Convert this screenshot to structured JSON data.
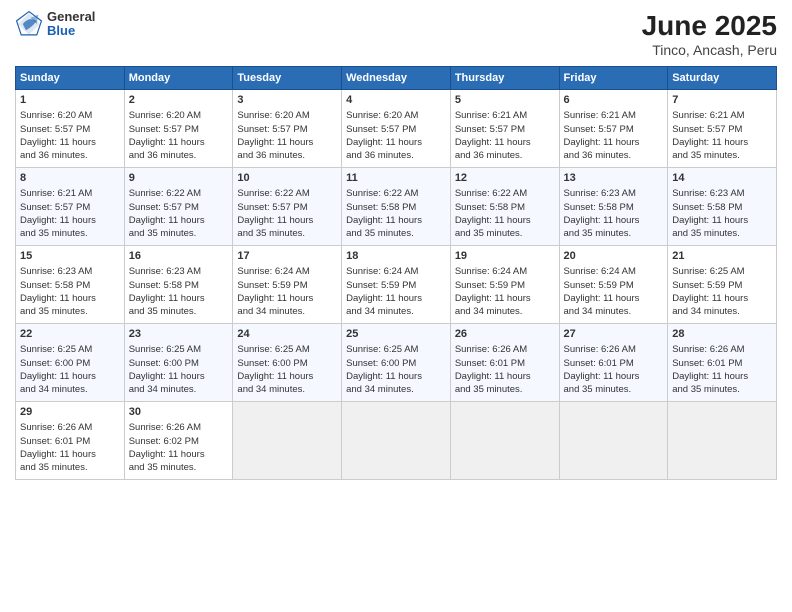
{
  "header": {
    "logo_general": "General",
    "logo_blue": "Blue",
    "main_title": "June 2025",
    "subtitle": "Tinco, Ancash, Peru"
  },
  "calendar": {
    "days_header": [
      "Sunday",
      "Monday",
      "Tuesday",
      "Wednesday",
      "Thursday",
      "Friday",
      "Saturday"
    ],
    "rows": [
      [
        {
          "day": "1",
          "lines": [
            "Sunrise: 6:20 AM",
            "Sunset: 5:57 PM",
            "Daylight: 11 hours",
            "and 36 minutes."
          ]
        },
        {
          "day": "2",
          "lines": [
            "Sunrise: 6:20 AM",
            "Sunset: 5:57 PM",
            "Daylight: 11 hours",
            "and 36 minutes."
          ]
        },
        {
          "day": "3",
          "lines": [
            "Sunrise: 6:20 AM",
            "Sunset: 5:57 PM",
            "Daylight: 11 hours",
            "and 36 minutes."
          ]
        },
        {
          "day": "4",
          "lines": [
            "Sunrise: 6:20 AM",
            "Sunset: 5:57 PM",
            "Daylight: 11 hours",
            "and 36 minutes."
          ]
        },
        {
          "day": "5",
          "lines": [
            "Sunrise: 6:21 AM",
            "Sunset: 5:57 PM",
            "Daylight: 11 hours",
            "and 36 minutes."
          ]
        },
        {
          "day": "6",
          "lines": [
            "Sunrise: 6:21 AM",
            "Sunset: 5:57 PM",
            "Daylight: 11 hours",
            "and 36 minutes."
          ]
        },
        {
          "day": "7",
          "lines": [
            "Sunrise: 6:21 AM",
            "Sunset: 5:57 PM",
            "Daylight: 11 hours",
            "and 35 minutes."
          ]
        }
      ],
      [
        {
          "day": "8",
          "lines": [
            "Sunrise: 6:21 AM",
            "Sunset: 5:57 PM",
            "Daylight: 11 hours",
            "and 35 minutes."
          ]
        },
        {
          "day": "9",
          "lines": [
            "Sunrise: 6:22 AM",
            "Sunset: 5:57 PM",
            "Daylight: 11 hours",
            "and 35 minutes."
          ]
        },
        {
          "day": "10",
          "lines": [
            "Sunrise: 6:22 AM",
            "Sunset: 5:57 PM",
            "Daylight: 11 hours",
            "and 35 minutes."
          ]
        },
        {
          "day": "11",
          "lines": [
            "Sunrise: 6:22 AM",
            "Sunset: 5:58 PM",
            "Daylight: 11 hours",
            "and 35 minutes."
          ]
        },
        {
          "day": "12",
          "lines": [
            "Sunrise: 6:22 AM",
            "Sunset: 5:58 PM",
            "Daylight: 11 hours",
            "and 35 minutes."
          ]
        },
        {
          "day": "13",
          "lines": [
            "Sunrise: 6:23 AM",
            "Sunset: 5:58 PM",
            "Daylight: 11 hours",
            "and 35 minutes."
          ]
        },
        {
          "day": "14",
          "lines": [
            "Sunrise: 6:23 AM",
            "Sunset: 5:58 PM",
            "Daylight: 11 hours",
            "and 35 minutes."
          ]
        }
      ],
      [
        {
          "day": "15",
          "lines": [
            "Sunrise: 6:23 AM",
            "Sunset: 5:58 PM",
            "Daylight: 11 hours",
            "and 35 minutes."
          ]
        },
        {
          "day": "16",
          "lines": [
            "Sunrise: 6:23 AM",
            "Sunset: 5:58 PM",
            "Daylight: 11 hours",
            "and 35 minutes."
          ]
        },
        {
          "day": "17",
          "lines": [
            "Sunrise: 6:24 AM",
            "Sunset: 5:59 PM",
            "Daylight: 11 hours",
            "and 34 minutes."
          ]
        },
        {
          "day": "18",
          "lines": [
            "Sunrise: 6:24 AM",
            "Sunset: 5:59 PM",
            "Daylight: 11 hours",
            "and 34 minutes."
          ]
        },
        {
          "day": "19",
          "lines": [
            "Sunrise: 6:24 AM",
            "Sunset: 5:59 PM",
            "Daylight: 11 hours",
            "and 34 minutes."
          ]
        },
        {
          "day": "20",
          "lines": [
            "Sunrise: 6:24 AM",
            "Sunset: 5:59 PM",
            "Daylight: 11 hours",
            "and 34 minutes."
          ]
        },
        {
          "day": "21",
          "lines": [
            "Sunrise: 6:25 AM",
            "Sunset: 5:59 PM",
            "Daylight: 11 hours",
            "and 34 minutes."
          ]
        }
      ],
      [
        {
          "day": "22",
          "lines": [
            "Sunrise: 6:25 AM",
            "Sunset: 6:00 PM",
            "Daylight: 11 hours",
            "and 34 minutes."
          ]
        },
        {
          "day": "23",
          "lines": [
            "Sunrise: 6:25 AM",
            "Sunset: 6:00 PM",
            "Daylight: 11 hours",
            "and 34 minutes."
          ]
        },
        {
          "day": "24",
          "lines": [
            "Sunrise: 6:25 AM",
            "Sunset: 6:00 PM",
            "Daylight: 11 hours",
            "and 34 minutes."
          ]
        },
        {
          "day": "25",
          "lines": [
            "Sunrise: 6:25 AM",
            "Sunset: 6:00 PM",
            "Daylight: 11 hours",
            "and 34 minutes."
          ]
        },
        {
          "day": "26",
          "lines": [
            "Sunrise: 6:26 AM",
            "Sunset: 6:01 PM",
            "Daylight: 11 hours",
            "and 35 minutes."
          ]
        },
        {
          "day": "27",
          "lines": [
            "Sunrise: 6:26 AM",
            "Sunset: 6:01 PM",
            "Daylight: 11 hours",
            "and 35 minutes."
          ]
        },
        {
          "day": "28",
          "lines": [
            "Sunrise: 6:26 AM",
            "Sunset: 6:01 PM",
            "Daylight: 11 hours",
            "and 35 minutes."
          ]
        }
      ],
      [
        {
          "day": "29",
          "lines": [
            "Sunrise: 6:26 AM",
            "Sunset: 6:01 PM",
            "Daylight: 11 hours",
            "and 35 minutes."
          ]
        },
        {
          "day": "30",
          "lines": [
            "Sunrise: 6:26 AM",
            "Sunset: 6:02 PM",
            "Daylight: 11 hours",
            "and 35 minutes."
          ]
        },
        {
          "day": "",
          "lines": []
        },
        {
          "day": "",
          "lines": []
        },
        {
          "day": "",
          "lines": []
        },
        {
          "day": "",
          "lines": []
        },
        {
          "day": "",
          "lines": []
        }
      ]
    ]
  }
}
